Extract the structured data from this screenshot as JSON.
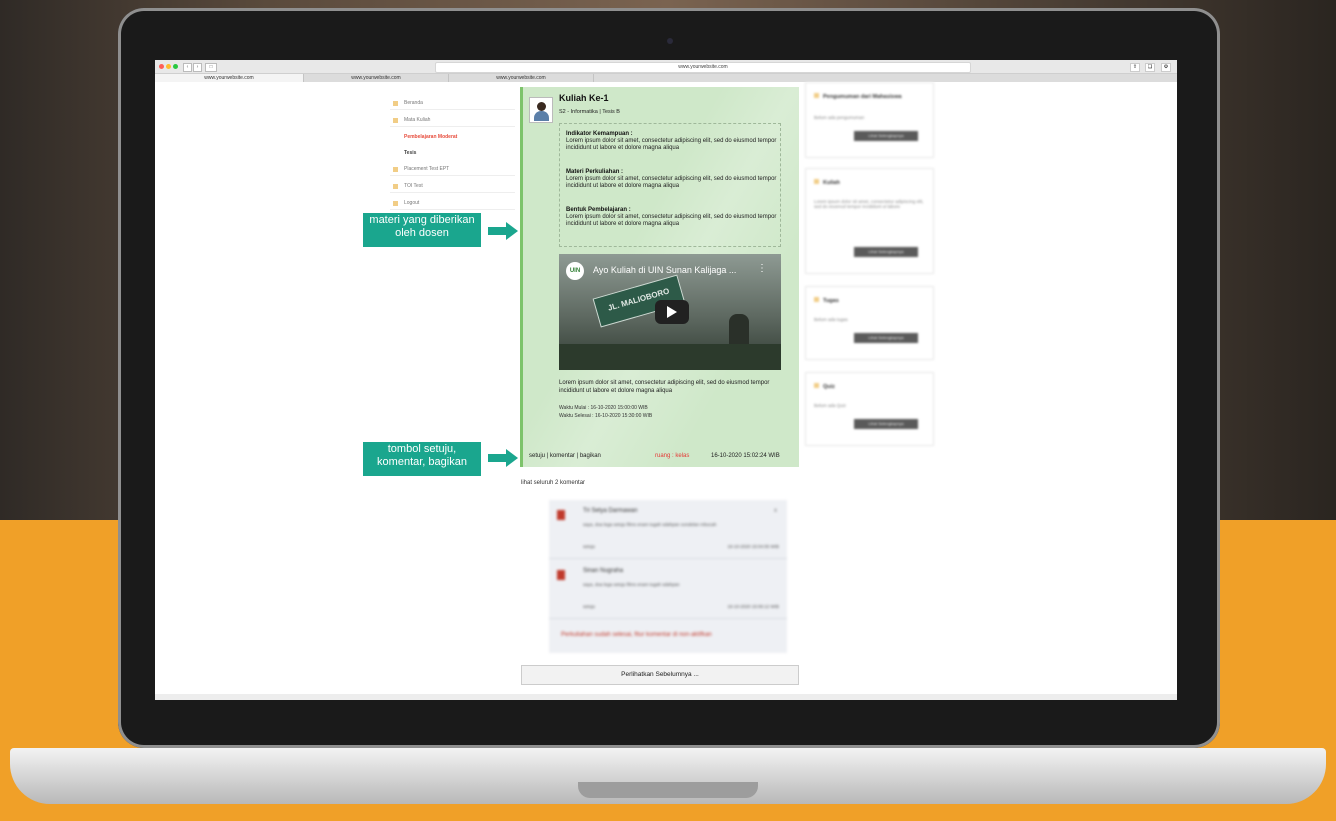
{
  "browser": {
    "url": "www.yourwebsite.com",
    "tabs": [
      "www.yourwebsite.com",
      "www.yourwebsite.com",
      "www.yourwebsite.com"
    ]
  },
  "sidebar": {
    "items": [
      {
        "label": "Beranda"
      },
      {
        "label": "Mata Kuliah"
      },
      {
        "label": "Pembelajaran Moderat"
      },
      {
        "label": "Tesis"
      },
      {
        "label": "Placement Test EPT"
      },
      {
        "label": "TOI Test"
      },
      {
        "label": "Logout"
      }
    ]
  },
  "post": {
    "title": "Kuliah Ke-1",
    "subtitle": "S2 - Informatika | Tesis B",
    "sections": [
      {
        "heading": "Indikator Kemampuan :",
        "text": "Lorem ipsum dolor sit amet, consectetur adipiscing elit, sed do eiusmod tempor incididunt ut labore et dolore magna aliqua"
      },
      {
        "heading": "Materi Perkuliahan :",
        "text": "Lorem ipsum dolor sit amet, consectetur adipiscing elit, sed do eiusmod tempor incididunt ut labore et dolore magna aliqua"
      },
      {
        "heading": "Bentuk Pembelajaran :",
        "text": "Lorem ipsum dolor sit amet, consectetur adipiscing elit, sed do eiusmod tempor incididunt ut labore et dolore magna aliqua"
      }
    ],
    "video": {
      "title": "Ayo Kuliah di UIN Sunan Kalijaga ...",
      "sign_text": "JL. MALIOBORO",
      "logo_text": "UIN"
    },
    "description": "Lorem ipsum dolor sit amet, consectetur adipiscing elit, sed do eiusmod tempor incididunt ut labore et dolore magna aliqua",
    "waktu_mulai": "Waktu Mulai    : 16-10-2020 15:00:00 WIB",
    "waktu_selesai": "Waktu Selesai  : 16-10-2020 15:30:00 WIB",
    "footer": {
      "setuju": "setuju",
      "komentar": "komentar",
      "bagikan": "bagikan",
      "separator": " | ",
      "room": "ruang : kelas",
      "timestamp": "16-10-2020 15:02:24 WIB"
    }
  },
  "callouts": {
    "materi": "materi yang diberikan oleh dosen",
    "tombol": "tombol setuju, komentar, bagikan"
  },
  "comments": {
    "view_all": "lihat seluruh 2 komentar",
    "items": [
      {
        "name": "Tri Setya Darmawan",
        "text": "saya, doa lega setuju films enam tugah sdahpan sondelan mbucah",
        "like": "setuju",
        "time": "16-10-2020 15:04:05 WIB",
        "close": "x"
      },
      {
        "name": "Sinan Nugraha",
        "text": "saya, doa lega setuju films enam tugah sdahpan",
        "like": "setuju",
        "time": "16-10-2020 15:06:12 WIB",
        "close": ""
      }
    ],
    "notice": "Perkuliahan sudah selesai, fitur komentar di non-aktifkan",
    "more_button": "Perlihatkan Sebelumnya ..."
  },
  "widgets": [
    {
      "title": "Pengumuman dari Mahasiswa",
      "text": "Belum ada pengumuman",
      "button": "Lihat Selengkapnya"
    },
    {
      "title": "Kuliah",
      "text": "Lorem ipsum dolor sit amet, consectetur adipiscing elit, sed do eiusmod tempor incididunt ut labore",
      "button": "Lihat Selengkapnya"
    },
    {
      "title": "Tugas",
      "text": "Belum ada tugas",
      "button": "Lihat Selengkapnya"
    },
    {
      "title": "Quiz",
      "text": "Belum ada Quiz",
      "button": "Lihat Selengkapnya"
    }
  ],
  "colors": {
    "accent": "#1aa68e",
    "post_bg": "#cfe8c9",
    "post_border": "#7dc36b",
    "room": "#e53935",
    "background": "#f0a028"
  }
}
